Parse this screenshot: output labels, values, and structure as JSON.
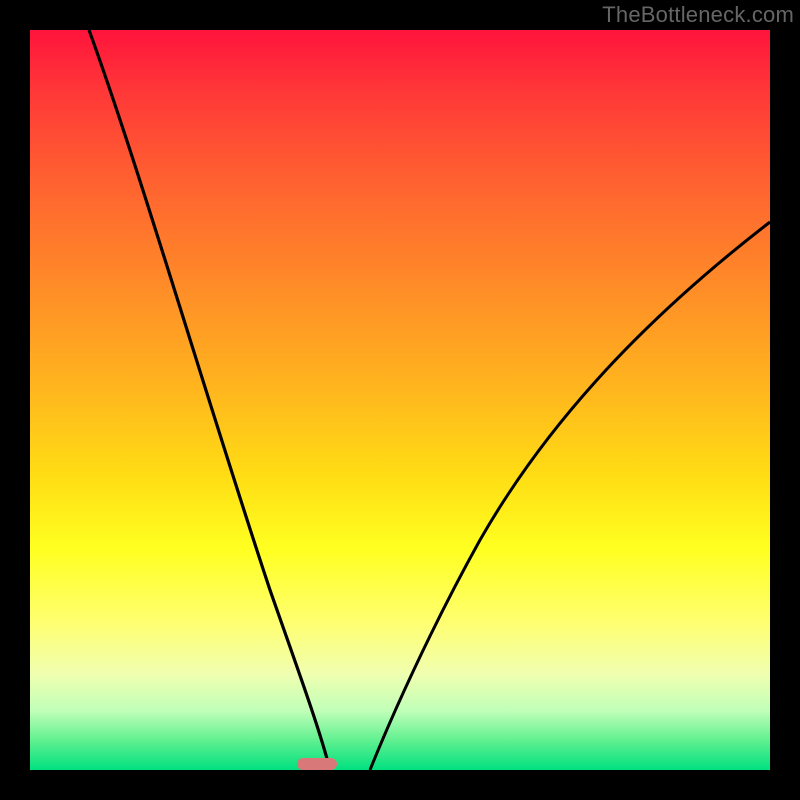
{
  "watermark": {
    "text": "TheBottleneck.com"
  },
  "chart_data": {
    "type": "line",
    "title": "",
    "xlabel": "",
    "ylabel": "",
    "xlim": [
      0,
      100
    ],
    "ylim": [
      0,
      100
    ],
    "gradient_stops": [
      {
        "pos": 0,
        "color": "#ff143c"
      },
      {
        "pos": 20,
        "color": "#ff6030"
      },
      {
        "pos": 48,
        "color": "#ffb41e"
      },
      {
        "pos": 70,
        "color": "#ffff20"
      },
      {
        "pos": 92,
        "color": "#c0ffb8"
      },
      {
        "pos": 100,
        "color": "#00e080"
      }
    ],
    "series": [
      {
        "name": "left-branch",
        "x": [
          8,
          12,
          16,
          20,
          24,
          28,
          31,
          34,
          36,
          38,
          39.5,
          40.5
        ],
        "values": [
          100,
          89,
          77,
          66,
          55,
          43,
          33,
          23,
          15,
          8,
          3,
          0
        ]
      },
      {
        "name": "right-branch",
        "x": [
          46,
          48,
          51,
          55,
          60,
          66,
          73,
          81,
          90,
          100
        ],
        "values": [
          0,
          4,
          11,
          20,
          30,
          40,
          50,
          59,
          67,
          74
        ]
      }
    ],
    "marker": {
      "x": 43,
      "y": 0,
      "color": "#d87878"
    }
  }
}
